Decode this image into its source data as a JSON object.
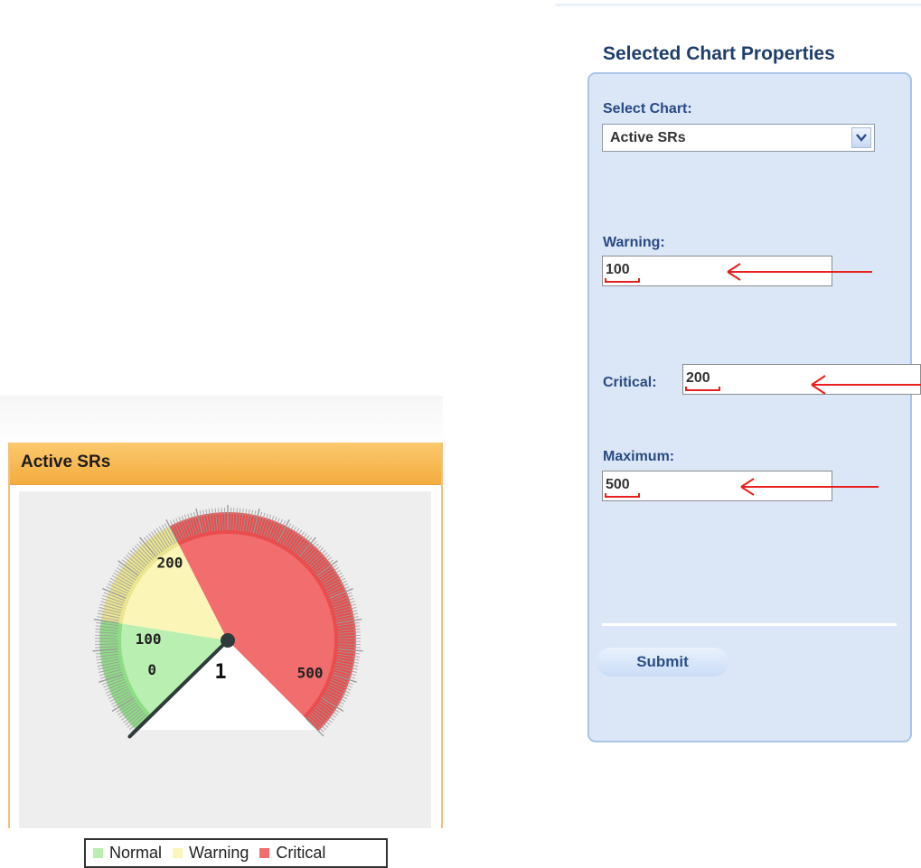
{
  "gauge_widget": {
    "title": "Active SRs",
    "value_display": "1",
    "legend": [
      {
        "label": "Normal",
        "color": "#b9f0b1"
      },
      {
        "label": "Warning",
        "color": "#fbf5b8"
      },
      {
        "label": "Critical",
        "color": "#f26d6d"
      }
    ]
  },
  "chart_data": {
    "type": "gauge",
    "title": "Active SRs",
    "value": 1,
    "min": 0,
    "max": 500,
    "tick_labels": [
      "0",
      "100",
      "200",
      "500"
    ],
    "bands": [
      {
        "name": "Normal",
        "from": 0,
        "to": 100,
        "color": "#b9f0b1"
      },
      {
        "name": "Warning",
        "from": 100,
        "to": 200,
        "color": "#fbf5b8"
      },
      {
        "name": "Critical",
        "from": 200,
        "to": 500,
        "color": "#f26d6d"
      }
    ]
  },
  "properties_panel": {
    "title": "Selected Chart Properties",
    "select_chart_label": "Select Chart:",
    "select_chart_value": "Active SRs",
    "warning_label": "Warning:",
    "warning_value": "100",
    "critical_label": "Critical:",
    "critical_value": "200",
    "maximum_label": "Maximum:",
    "maximum_value": "500",
    "submit_label": "Submit"
  },
  "icons": {
    "dropdown": "chevron-down-icon",
    "annotation": "red-arrow-left-icon"
  },
  "colors": {
    "header_orange": "#f4ac3e",
    "panel_blue": "#dbe7f7",
    "label_blue": "#2a4a82",
    "annotation_red": "#e8201e"
  }
}
